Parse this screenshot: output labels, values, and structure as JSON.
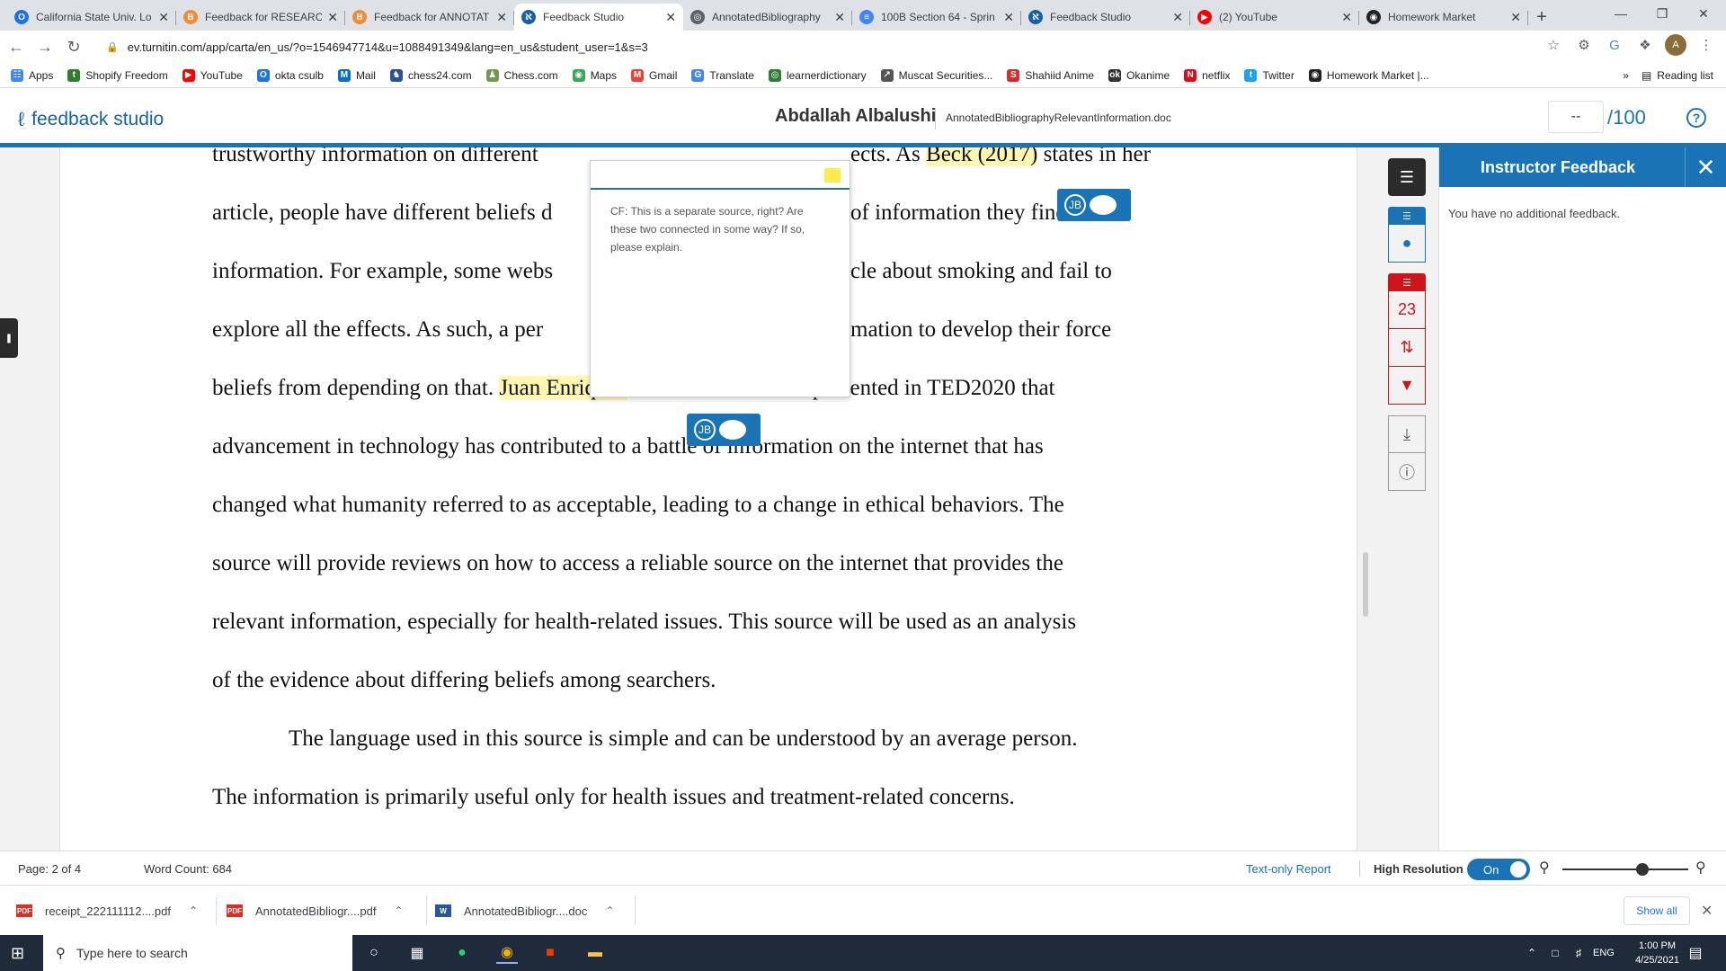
{
  "browser": {
    "tabs": [
      {
        "title": "California State Univ. Lo",
        "color": "#1a73e8",
        "glyph": "O"
      },
      {
        "title": "Feedback for RESEARCH",
        "color": "#f28b35",
        "glyph": "B"
      },
      {
        "title": "Feedback for ANNOTAT",
        "color": "#f28b35",
        "glyph": "B"
      },
      {
        "title": "Feedback Studio",
        "color": "#1561a8",
        "glyph": "ℵ",
        "active": true
      },
      {
        "title": "AnnotatedBibliography",
        "color": "#5f6368",
        "glyph": "◎"
      },
      {
        "title": "100B Section 64 - Sprin",
        "color": "#4285f4",
        "glyph": "≡"
      },
      {
        "title": "Feedback Studio",
        "color": "#1561a8",
        "glyph": "ℵ"
      },
      {
        "title": "(2) YouTube",
        "color": "#ff0000",
        "glyph": "▶"
      },
      {
        "title": "Homework Market",
        "color": "#222",
        "glyph": "◉"
      }
    ],
    "url": "ev.turnitin.com/app/carta/en_us/?o=1546947714&u=1088491349&lang=en_us&student_user=1&s=3",
    "bookmarks": [
      {
        "label": "Apps",
        "color": "#4285f4",
        "glyph": "☷"
      },
      {
        "label": "Shopify Freedom",
        "color": "#2e7d32",
        "glyph": "t"
      },
      {
        "label": "YouTube",
        "color": "#ff0000",
        "glyph": "▶"
      },
      {
        "label": "okta csulb",
        "color": "#1a73e8",
        "glyph": "O"
      },
      {
        "label": "Mail",
        "color": "#0072c6",
        "glyph": "M"
      },
      {
        "label": "chess24.com",
        "color": "#2a5298",
        "glyph": "♞"
      },
      {
        "label": "Chess.com",
        "color": "#769656",
        "glyph": "♟"
      },
      {
        "label": "Maps",
        "color": "#34a853",
        "glyph": "◉"
      },
      {
        "label": "Gmail",
        "color": "#ea4335",
        "glyph": "M"
      },
      {
        "label": "Translate",
        "color": "#4285f4",
        "glyph": "G"
      },
      {
        "label": "learnerdictionary",
        "color": "#2e7d32",
        "glyph": "◎"
      },
      {
        "label": "Muscat Securities...",
        "color": "#555",
        "glyph": "↗"
      },
      {
        "label": "Shahiid Anime",
        "color": "#d32f2f",
        "glyph": "S"
      },
      {
        "label": "Okanime",
        "color": "#333",
        "glyph": "ok"
      },
      {
        "label": "netflix",
        "color": "#e50914",
        "glyph": "N"
      },
      {
        "label": "Twitter",
        "color": "#1da1f2",
        "glyph": "t"
      },
      {
        "label": "Homework Market |...",
        "color": "#222",
        "glyph": "◉"
      }
    ],
    "more_bookmarks": "»",
    "reading_list": "Reading list"
  },
  "header": {
    "logo": "feedback studio",
    "student": "Abdallah Albalushi",
    "document": "AnnotatedBibliographyRelevantInformation.doc",
    "grade": "--",
    "out_of": "/100"
  },
  "document": {
    "lines": [
      {
        "pre": "trustworthy information on different ",
        "hl": "",
        "post": "",
        "partial": true
      },
      {
        "pre": "article, people have different beliefs d",
        "hl": "",
        "post": "",
        "tail": "of information they find"
      },
      {
        "pre": "information. For example, some webs",
        "hl": "",
        "post": "",
        "tail": "cle about smoking and fail to"
      },
      {
        "pre": "explore all the effects. As such, a per",
        "hl": "",
        "post": "",
        "tail": "mation to develop their force"
      },
      {
        "pre": "beliefs from depending on that. ",
        "hl": "Juan Enriquez",
        "post": " confirms in a video presented in TED2020 that"
      },
      {
        "pre": "advancement in technology has contributed to a battle of information on the internet that has",
        "hl": "",
        "post": ""
      },
      {
        "pre": "changed what humanity referred to as acceptable, leading to a change in ethical behaviors. The",
        "hl": "",
        "post": ""
      },
      {
        "pre": "source will provide reviews on how to access a reliable source on the internet that provides the",
        "hl": "",
        "post": ""
      },
      {
        "pre": "relevant information, especially for health-related issues. This source will be used as an analysis",
        "hl": "",
        "post": ""
      },
      {
        "pre": "of the evidence about differing beliefs among searchers.",
        "hl": "",
        "post": ""
      },
      {
        "pre": "The language used in this source is simple and can be understood by an average person.",
        "hl": "",
        "post": "",
        "indent": true
      },
      {
        "pre": "The information is primarily useful only for health issues and treatment-related concerns.",
        "hl": "",
        "post": ""
      }
    ],
    "top_right_fragment": {
      "pre": "ects. As ",
      "hl": "Beck (2017)",
      "post": " states in her"
    },
    "comment": "CF: This is a separate source, right? Are these two connected in some way? If so, please explain.",
    "bubble_initials": "JB"
  },
  "sidebar_icons": {
    "comment_count": "23"
  },
  "panel": {
    "title": "Instructor Feedback",
    "body": "You have no additional feedback."
  },
  "status": {
    "page": "Page: 2 of 4",
    "words": "Word Count: 684",
    "text_only": "Text-only Report",
    "high_res": "High Resolution",
    "toggle": "On"
  },
  "downloads": [
    {
      "name": "receipt_222111112....pdf",
      "type": "PDF",
      "color": "#d93025"
    },
    {
      "name": "AnnotatedBibliogr....pdf",
      "type": "PDF",
      "color": "#d93025"
    },
    {
      "name": "AnnotatedBibliogr....doc",
      "type": "W",
      "color": "#2b579a"
    }
  ],
  "show_all": "Show all",
  "taskbar": {
    "search_placeholder": "Type here to search",
    "lang": "ENG",
    "time": "1:00 PM",
    "date": "4/25/2021"
  }
}
